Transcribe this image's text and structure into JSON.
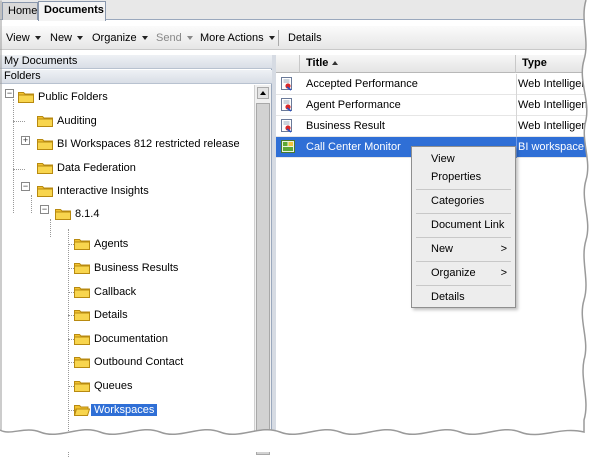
{
  "tabs": [
    {
      "label": "Home",
      "active": false
    },
    {
      "label": "Documents",
      "active": true
    }
  ],
  "toolbar": {
    "view": "View",
    "new": "New",
    "organize": "Organize",
    "send": "Send",
    "more_actions": "More Actions",
    "details": "Details"
  },
  "left_pane": {
    "my_documents": "My Documents",
    "folders": "Folders",
    "tree": {
      "public_folders": "Public Folders",
      "auditing": "Auditing",
      "bi_workspaces": "BI Workspaces 812 restricted release",
      "data_federation": "Data Federation",
      "interactive_insights": "Interactive Insights",
      "version": "8.1.4",
      "agents": "Agents",
      "business_results": "Business Results",
      "callback": "Callback",
      "details": "Details",
      "documentation": "Documentation",
      "outbound_contact": "Outbound Contact",
      "queues": "Queues",
      "workspaces": "Workspaces"
    }
  },
  "document_list": {
    "columns": [
      "Title",
      "Type"
    ],
    "rows": [
      {
        "title": "Accepted Performance",
        "type": "Web Intelligence",
        "icon": "webi-report-icon"
      },
      {
        "title": "Agent Performance",
        "type": "Web Intelligence",
        "icon": "webi-report-icon"
      },
      {
        "title": "Business Result",
        "type": "Web Intelligence",
        "icon": "webi-report-icon"
      },
      {
        "title": "Call Center Monitor",
        "type": "BI workspace",
        "icon": "bi-workspace-icon",
        "selected": true
      }
    ]
  },
  "context_menu": {
    "view": "View",
    "properties": "Properties",
    "categories": "Categories",
    "document_link": "Document Link",
    "new": "New",
    "organize": "Organize",
    "details": "Details",
    "submenu_glyph": ">"
  },
  "colors": {
    "selection": "#2f6fd6",
    "folder": "#f2c230",
    "menu_background": "#ededed"
  }
}
